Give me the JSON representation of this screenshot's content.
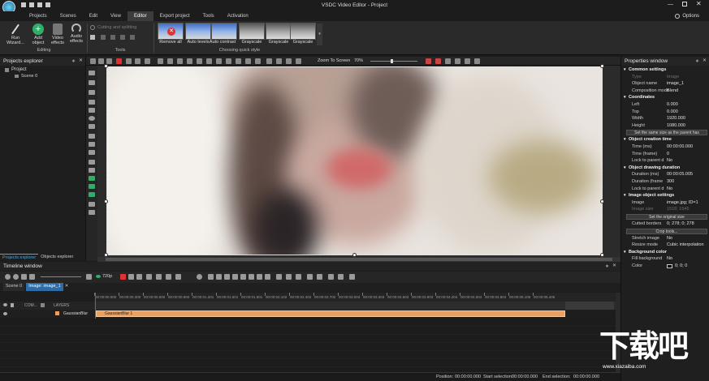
{
  "window": {
    "title": "VSDC Video Editor - Project",
    "options_label": "Options"
  },
  "menu": [
    "Projects",
    "Scenes",
    "Edit",
    "View",
    "Editor",
    "Export project",
    "Tools",
    "Activation"
  ],
  "ribbon": {
    "editing": {
      "buttons": [
        "Run Wizard...",
        "Add object",
        "Video effects",
        "Audio effects"
      ],
      "label": "Editing"
    },
    "tools": {
      "items": [
        "Cutting and splitting"
      ],
      "label": "Tools"
    },
    "quick_style": {
      "items": [
        "Remove all",
        "Auto levels",
        "Auto contrast",
        "Grayscale",
        "Grayscale",
        "Grayscale"
      ],
      "label": "Choosing quick style"
    }
  },
  "projects_explorer": {
    "title": "Projects explorer",
    "tree": [
      "Project",
      "Scene 0"
    ],
    "tabs": [
      "Projects explorer",
      "Objects explorer"
    ]
  },
  "toolbar": {
    "zoom_label": "Zoom To Screen",
    "zoom_percent": "70%"
  },
  "properties": {
    "title": "Properties window",
    "rows": [
      {
        "type": "sec",
        "k": "Common settings"
      },
      {
        "k": "Type",
        "v": "Image",
        "dim": true
      },
      {
        "k": "Object name",
        "v": "image_1"
      },
      {
        "k": "Composition mode",
        "v": "Blend"
      },
      {
        "type": "sec",
        "k": "Coordinates"
      },
      {
        "k": "Left",
        "v": "0.000"
      },
      {
        "k": "Top",
        "v": "0.000"
      },
      {
        "k": "Width",
        "v": "1920.000"
      },
      {
        "k": "Height",
        "v": "1080.000"
      },
      {
        "type": "btn",
        "k": "Set the same size as the parent has"
      },
      {
        "type": "sec",
        "k": "Object creation time"
      },
      {
        "k": "Time (ms)",
        "v": "00:00:00.000"
      },
      {
        "k": "Time (frame)",
        "v": "0"
      },
      {
        "k": "Lock to parent d",
        "v": "No"
      },
      {
        "type": "sec",
        "k": "Object drawing duration"
      },
      {
        "k": "Duration (ms)",
        "v": "00:00:05.005"
      },
      {
        "k": "Duration (frame",
        "v": "300"
      },
      {
        "k": "Lock to parent d",
        "v": "No"
      },
      {
        "type": "sec",
        "k": "Image object settings"
      },
      {
        "k": "Image",
        "v": "image.jpg; ID=1"
      },
      {
        "k": "Image size",
        "v": "1518; 1545",
        "dim": true
      },
      {
        "type": "btn",
        "k": "Set the original size"
      },
      {
        "k": "Cutted borders",
        "v": "0; 278; 0; 278"
      },
      {
        "type": "btn",
        "k": "Crop tools..."
      },
      {
        "k": "Stretch image",
        "v": "No"
      },
      {
        "k": "Resize mode",
        "v": "Cubic interpolation"
      },
      {
        "type": "sec",
        "k": "Background color"
      },
      {
        "k": "Fill background",
        "v": "No"
      },
      {
        "k": "Color",
        "v": "0; 0; 0"
      }
    ]
  },
  "timeline": {
    "title": "Timeline window",
    "resolution": "720p",
    "tabs": [
      "Scene 0",
      "Image: image_1"
    ],
    "header": [
      "COM...",
      "LAYERS"
    ],
    "track_name": "GaussianBlur",
    "clip_label": "GaussianBlur 1",
    "ruler": [
      "00:00:00.000",
      "00:00:00.300",
      "00:00:00.600",
      "00:00:00.900",
      "00:00:01.201",
      "00:00:01.501",
      "00:00:01.801",
      "00:00:02.102",
      "00:00:02.402",
      "00:00:02.702",
      "00:00:03.003",
      "00:00:03.303",
      "00:00:03.603",
      "00:00:03.903",
      "00:00:04.204",
      "00:00:04.504",
      "00:00:04.804",
      "00:00:05.105",
      "00:00:05.405"
    ]
  },
  "status": {
    "position_label": "Position:",
    "position": "00:00:00.000",
    "start_label": "Start selection:",
    "start": "00:00:00.000",
    "end_label": "End selection:",
    "end": "00:00:00.000"
  },
  "colors": {
    "accent": "#2fae6a",
    "clip": "#e8a063",
    "playhead": "#d33"
  },
  "watermark": {
    "text": "下载吧",
    "url": "www.xiazaiba.com"
  }
}
